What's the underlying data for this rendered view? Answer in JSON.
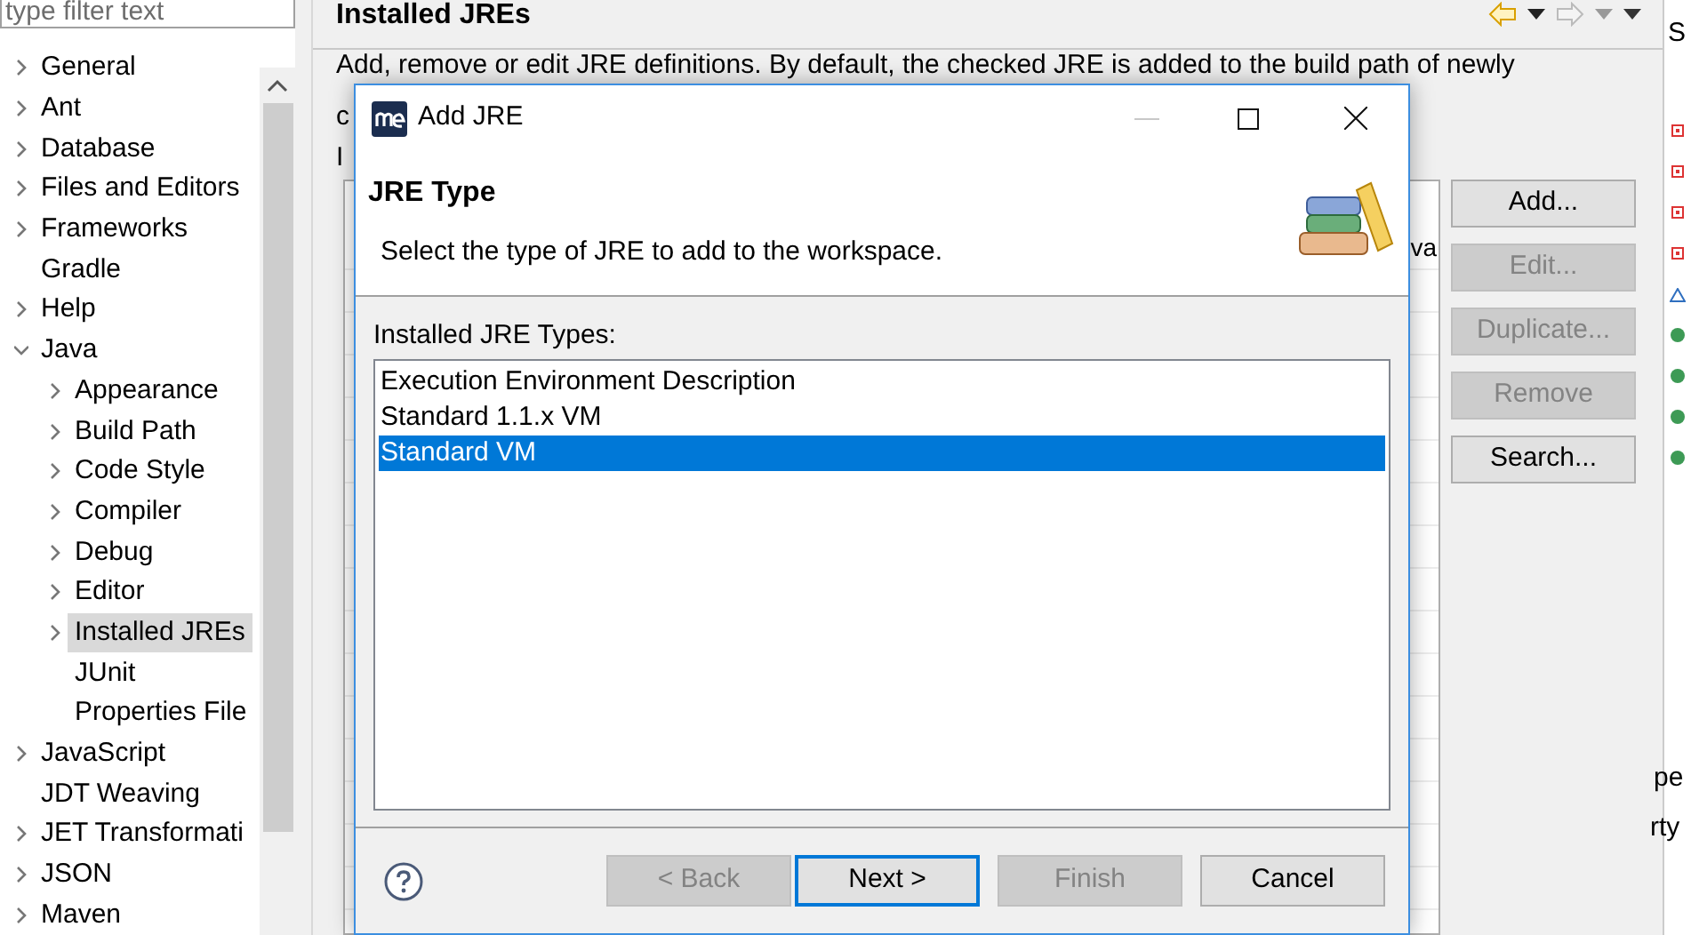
{
  "filter": {
    "placeholder": "type filter text"
  },
  "tree": [
    {
      "label": "General",
      "has_children": true,
      "expanded": false,
      "selected": false
    },
    {
      "label": "Ant",
      "has_children": true,
      "expanded": false,
      "selected": false
    },
    {
      "label": "Database",
      "has_children": true,
      "expanded": false,
      "selected": false
    },
    {
      "label": "Files and Editors",
      "has_children": true,
      "expanded": false,
      "selected": false
    },
    {
      "label": "Frameworks",
      "has_children": true,
      "expanded": false,
      "selected": false
    },
    {
      "label": "Gradle",
      "has_children": false,
      "expanded": false,
      "selected": false
    },
    {
      "label": "Help",
      "has_children": true,
      "expanded": false,
      "selected": false
    },
    {
      "label": "Java",
      "has_children": true,
      "expanded": true,
      "selected": false,
      "children": [
        {
          "label": "Appearance",
          "has_children": true,
          "expanded": false,
          "selected": false
        },
        {
          "label": "Build Path",
          "has_children": true,
          "expanded": false,
          "selected": false
        },
        {
          "label": "Code Style",
          "has_children": true,
          "expanded": false,
          "selected": false
        },
        {
          "label": "Compiler",
          "has_children": true,
          "expanded": false,
          "selected": false
        },
        {
          "label": "Debug",
          "has_children": true,
          "expanded": false,
          "selected": false
        },
        {
          "label": "Editor",
          "has_children": true,
          "expanded": false,
          "selected": false
        },
        {
          "label": "Installed JREs",
          "has_children": true,
          "expanded": false,
          "selected": true
        },
        {
          "label": "JUnit",
          "has_children": false,
          "expanded": false,
          "selected": false
        },
        {
          "label": "Properties File",
          "has_children": false,
          "expanded": false,
          "selected": false
        }
      ]
    },
    {
      "label": "JavaScript",
      "has_children": true,
      "expanded": false,
      "selected": false
    },
    {
      "label": "JDT Weaving",
      "has_children": false,
      "expanded": false,
      "selected": false
    },
    {
      "label": "JET Transformati",
      "has_children": true,
      "expanded": false,
      "selected": false
    },
    {
      "label": "JSON",
      "has_children": true,
      "expanded": false,
      "selected": false
    },
    {
      "label": "Maven",
      "has_children": true,
      "expanded": false,
      "selected": false
    }
  ],
  "page": {
    "title": "Installed JREs",
    "description": "Add, remove or edit JRE definitions. By default, the checked JRE is added to the build path of newly",
    "description_line_2": "c",
    "table_label": "I",
    "table_cell": "va",
    "buttons": [
      {
        "label": "Add...",
        "disabled": false
      },
      {
        "label": "Edit...",
        "disabled": true
      },
      {
        "label": "Duplicate...",
        "disabled": true
      },
      {
        "label": "Remove",
        "disabled": true
      },
      {
        "label": "Search..."
      }
    ]
  },
  "side_strip": {
    "top_text": "S",
    "markers": [
      {
        "kind": "error"
      },
      {
        "kind": "error"
      },
      {
        "kind": "error"
      },
      {
        "kind": "error"
      },
      {
        "kind": "warning"
      },
      {
        "kind": "ok"
      },
      {
        "kind": "ok"
      },
      {
        "kind": "ok"
      },
      {
        "kind": "ok"
      }
    ],
    "texts": [
      "pe",
      "rty"
    ]
  },
  "dialog": {
    "title": "Add JRE",
    "heading": "JRE Type",
    "message": "Select the type of JRE to add to the workspace.",
    "list_label": "Installed JRE Types:",
    "types": [
      {
        "label": "Execution Environment Description",
        "selected": false
      },
      {
        "label": "Standard 1.1.x VM",
        "selected": false
      },
      {
        "label": "Standard VM",
        "selected": true
      }
    ],
    "buttons": [
      {
        "label": "< Back",
        "disabled": true,
        "default": false
      },
      {
        "label": "Next >",
        "disabled": false,
        "default": true
      },
      {
        "label": "Finish",
        "disabled": true,
        "default": false
      },
      {
        "label": "Cancel",
        "disabled": false,
        "default": false
      }
    ]
  }
}
